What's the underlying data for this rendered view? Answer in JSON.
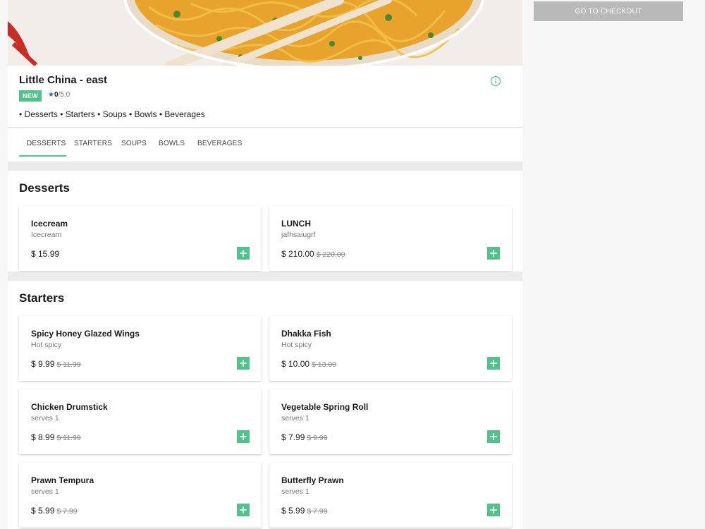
{
  "restaurant": {
    "name": "Little China - east",
    "badge": "NEW",
    "rating_value": "0",
    "rating_max": "/5.0",
    "categories": "• Desserts • Starters • Soups • Bowls • Beverages"
  },
  "tabs": [
    {
      "label": "DESSERTS",
      "active": true
    },
    {
      "label": "STARTERS"
    },
    {
      "label": "SOUPS"
    },
    {
      "label": "BOWLS"
    },
    {
      "label": "BEVERAGES"
    }
  ],
  "checkout": {
    "label": "GO TO CHECKOUT"
  },
  "sections": [
    {
      "title": "Desserts",
      "items": [
        {
          "name": "Icecream",
          "desc": "Icecream",
          "price": "$ 15.99",
          "old_price": ""
        },
        {
          "name": "LUNCH",
          "desc": "jafhsaiugrf",
          "price": "$ 210.00",
          "old_price": "$ 220.00"
        }
      ]
    },
    {
      "title": "Starters",
      "items": [
        {
          "name": "Spicy Honey Glazed Wings",
          "desc": "Hot spicy",
          "price": "$ 9.99",
          "old_price": "$ 11.99"
        },
        {
          "name": "Dhakka Fish",
          "desc": "Hot spicy",
          "price": "$ 10.00",
          "old_price": "$ 13.00"
        },
        {
          "name": "Chicken Drumstick",
          "desc": "serves 1",
          "price": "$ 8.99",
          "old_price": "$ 11.99"
        },
        {
          "name": "Vegetable Spring Roll",
          "desc": "serves 1",
          "price": "$ 7.99",
          "old_price": "$ 9.99"
        },
        {
          "name": "Prawn Tempura",
          "desc": "serves 1",
          "price": "$ 5.99",
          "old_price": "$ 7.99"
        },
        {
          "name": "Butterfly Prawn",
          "desc": "serves 1",
          "price": "$ 5.99",
          "old_price": "$ 7.99"
        }
      ]
    }
  ],
  "icons": {
    "info": "info-circle-icon",
    "star": "star-icon",
    "add": "plus-icon"
  },
  "colors": {
    "accent": "#4fc38a",
    "rating_star": "#2b6cb0",
    "checkout_bg": "#b9b9b9"
  }
}
